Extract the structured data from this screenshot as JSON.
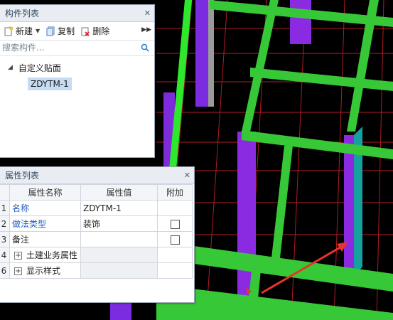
{
  "component_panel": {
    "title": "构件列表",
    "toolbar": {
      "new_label": "新建",
      "copy_label": "复制",
      "delete_label": "删除"
    },
    "search_placeholder": "搜索构件...",
    "tree": {
      "root_label": "自定义贴面",
      "child_label": "ZDYTM-1"
    }
  },
  "property_panel": {
    "title": "属性列表",
    "headers": {
      "name": "属性名称",
      "value": "属性值",
      "extra": "附加"
    },
    "rows": [
      {
        "num": "1",
        "name": "名称",
        "value": "ZDYTM-1"
      },
      {
        "num": "2",
        "name": "做法类型",
        "value": "装饰"
      },
      {
        "num": "3",
        "name": "备注",
        "value": ""
      },
      {
        "num": "4",
        "name": "土建业务属性",
        "value": ""
      },
      {
        "num": "6",
        "name": "显示样式",
        "value": ""
      }
    ]
  },
  "colors": {
    "beam": "#37c837",
    "column": "#8a2be2",
    "grid": "#e0202a",
    "arrow": "#e8342a",
    "link": "#1f5fbf"
  }
}
